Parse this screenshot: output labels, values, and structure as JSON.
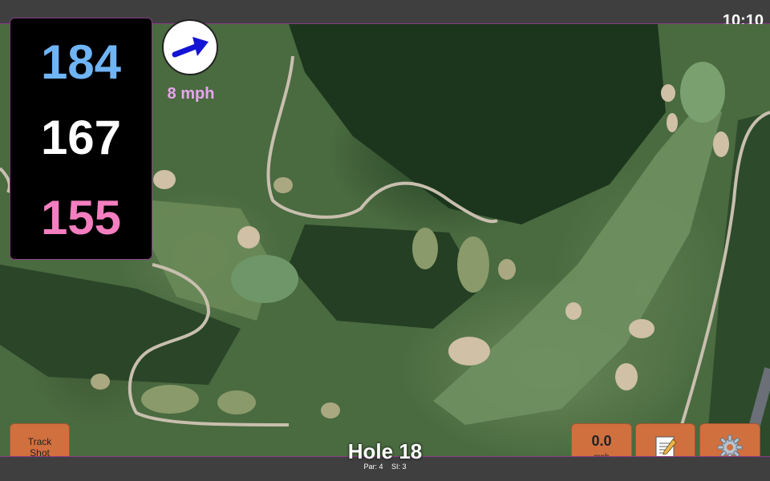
{
  "status": {
    "time": "10:10"
  },
  "distances": {
    "back": "184",
    "middle": "167",
    "front": "155"
  },
  "wind": {
    "speed_label": "8 mph",
    "direction_icon": "wind-arrow-icon"
  },
  "hole": {
    "title": "Hole 18",
    "par": "Par: 4",
    "si": "SI: 3"
  },
  "buttons": {
    "track_shot": "Track\nShot",
    "wind_value": "0.0",
    "wind_unit": "mph",
    "scorecard_icon": "notepad-icon",
    "settings_icon": "gear-icon"
  },
  "colors": {
    "back": "#6fb4f5",
    "middle": "#ffffff",
    "front": "#f57ec0",
    "button": "#d0703f",
    "wind_text": "#e8a5f0"
  }
}
